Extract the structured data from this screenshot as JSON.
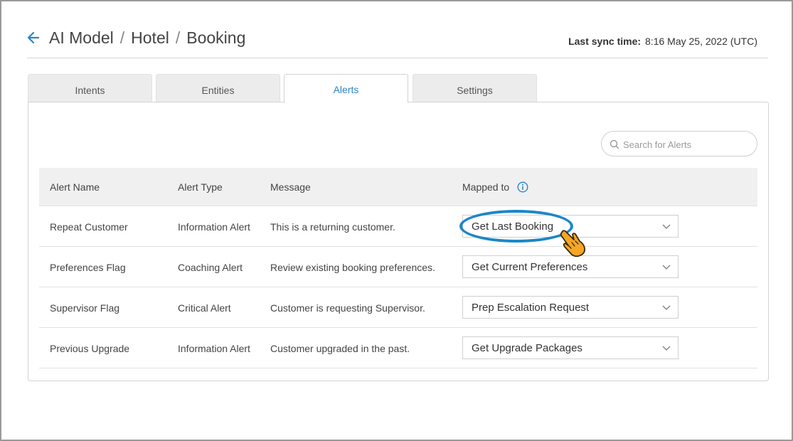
{
  "header": {
    "back_icon": "arrow-left-icon",
    "breadcrumbs": [
      "AI Model",
      "Hotel",
      "Booking"
    ],
    "separator": "/",
    "sync_label": "Last sync time:",
    "sync_value": "8:16 May 25, 2022 (UTC)"
  },
  "tabs": [
    {
      "label": "Intents"
    },
    {
      "label": "Entities"
    },
    {
      "label": "Alerts",
      "active": true
    },
    {
      "label": "Settings"
    }
  ],
  "search": {
    "placeholder": "Search for Alerts",
    "value": "",
    "icon": "search-icon"
  },
  "table": {
    "columns": [
      "Alert Name",
      "Alert Type",
      "Message",
      "Mapped to"
    ],
    "rows": [
      {
        "name": "Repeat Customer",
        "type": "Information Alert",
        "message": "This is a returning customer.",
        "mapped": "Get Last Booking"
      },
      {
        "name": "Preferences Flag",
        "type": "Coaching Alert",
        "message": "Review existing booking preferences.",
        "mapped": "Get Current Preferences"
      },
      {
        "name": "Supervisor Flag",
        "type": "Critical Alert",
        "message": "Customer is requesting Supervisor.",
        "mapped": "Prep Escalation Request"
      },
      {
        "name": "Previous Upgrade",
        "type": "Information Alert",
        "message": "Customer upgraded in the past.",
        "mapped": "Get Upgrade Packages"
      }
    ]
  },
  "colors": {
    "accent": "#2a86c9",
    "highlight": "#1c86c8",
    "pointer": "#f5a623"
  }
}
